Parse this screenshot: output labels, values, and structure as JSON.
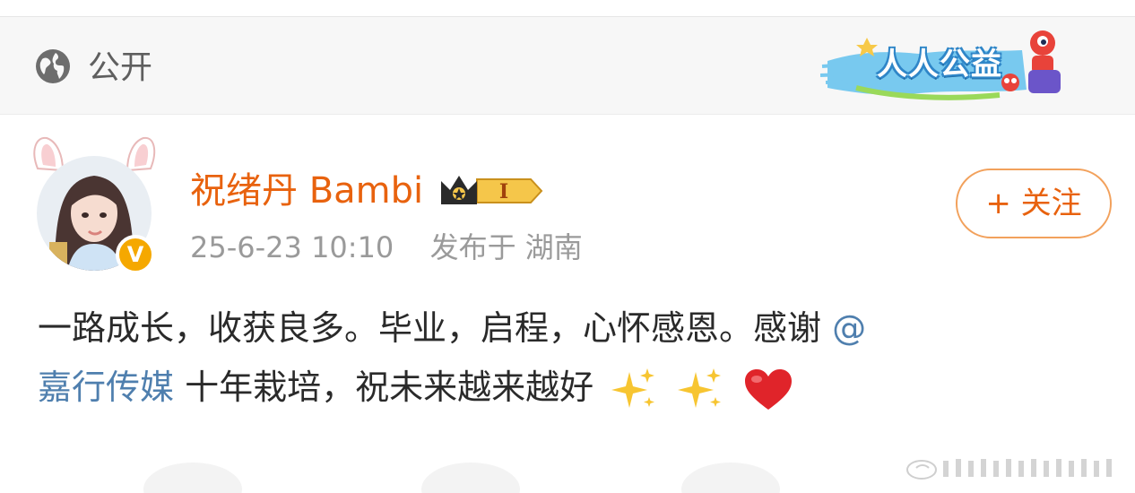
{
  "visibility": {
    "icon": "globe-icon",
    "label": "公开"
  },
  "charity_banner": {
    "label": "人人公益",
    "icon": "charity-mascot-icon"
  },
  "author": {
    "name": "祝绪丹 Bambi",
    "member_badge": "I",
    "verified_mark": "V",
    "avatar": "avatar-photo"
  },
  "post_meta": {
    "date": "25-6-23 10:10",
    "published_at": "发布于 湖南"
  },
  "follow_button": {
    "label": "+ 关注"
  },
  "post": {
    "line1_text": "一路成长，收获良多。毕业，启程，心怀感恩。感谢 ",
    "mention_part1": "@",
    "mention_part2": "嘉行传媒",
    "line2_text": " 十年栽培，祝未来越来越好 ",
    "emojis": [
      "sparkles-icon",
      "sparkles-icon",
      "red-heart-icon"
    ]
  },
  "colors": {
    "username": "#e8620e",
    "mention": "#4f7fae",
    "follow_border": "#f2a15c",
    "meta_text": "#9a9a9a",
    "verified_badge": "#f5a800"
  }
}
